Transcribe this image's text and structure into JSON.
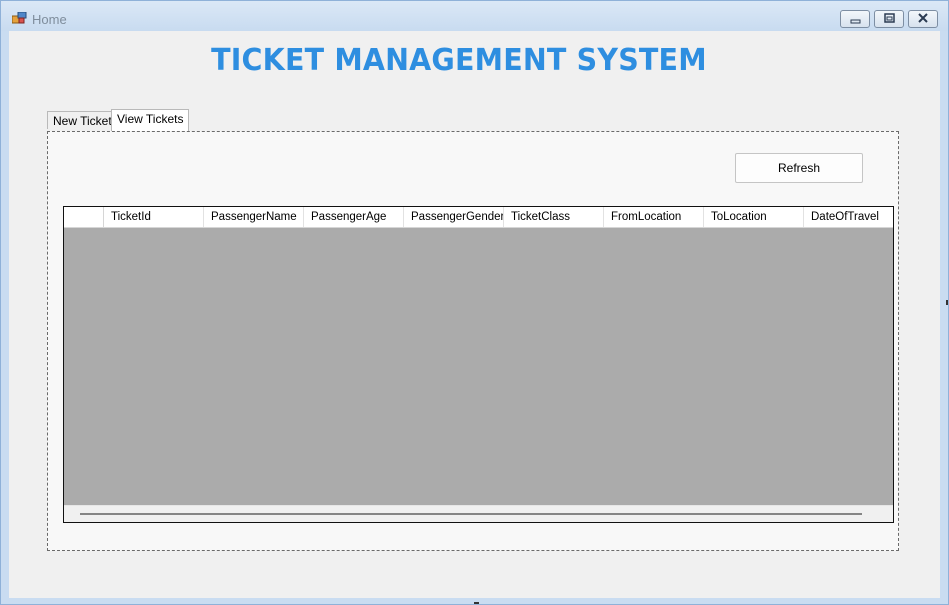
{
  "window": {
    "title": "Home",
    "controls": [
      "minimize-icon",
      "maximize-icon",
      "close-icon"
    ]
  },
  "app": {
    "heading": "TICKET MANAGEMENT SYSTEM",
    "heading_color": "#2e8ee0"
  },
  "tabs": [
    {
      "label": "New Ticket",
      "active": false
    },
    {
      "label": "View Tickets",
      "active": true
    }
  ],
  "view_tickets": {
    "refresh_label": "Refresh",
    "grid": {
      "columns": [
        "TicketId",
        "PassengerName",
        "PassengerAge",
        "PassengerGender",
        "TicketClass",
        "FromLocation",
        "ToLocation",
        "DateOfTravel"
      ],
      "rows": [],
      "background": "#ababab"
    }
  }
}
